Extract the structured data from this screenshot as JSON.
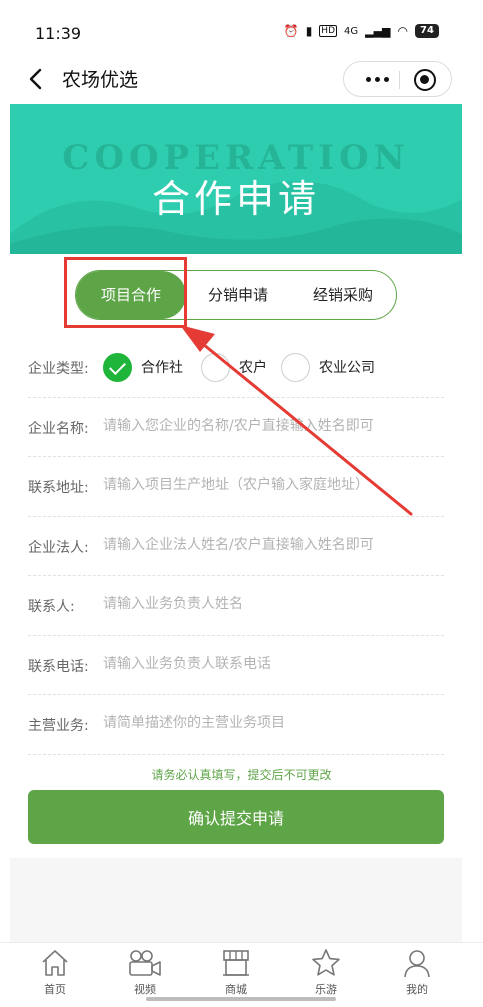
{
  "status_bar": {
    "time": "11:39",
    "network": "4G",
    "battery": "74"
  },
  "nav": {
    "title": "农场优选"
  },
  "banner": {
    "bg_text": "COOPERATION",
    "title": "合作申请"
  },
  "tabs": [
    {
      "label": "项目合作",
      "active": true
    },
    {
      "label": "分销申请",
      "active": false
    },
    {
      "label": "经销采购",
      "active": false
    }
  ],
  "form": {
    "type_label": "企业类型:",
    "type_options": [
      {
        "label": "合作社",
        "checked": true
      },
      {
        "label": "农户",
        "checked": false
      },
      {
        "label": "农业公司",
        "checked": false
      }
    ],
    "fields": [
      {
        "label": "企业名称:",
        "placeholder": "请输入您企业的名称/农户直接输入姓名即可"
      },
      {
        "label": "联系地址:",
        "placeholder": "请输入项目生产地址（农户输入家庭地址）"
      },
      {
        "label": "企业法人:",
        "placeholder": "请输入企业法人姓名/农户直接输入姓名即可"
      },
      {
        "label": "联系人:",
        "placeholder": "请输入业务负责人姓名"
      },
      {
        "label": "联系电话:",
        "placeholder": "请输入业务负责人联系电话"
      },
      {
        "label": "主营业务:",
        "placeholder": "请简单描述你的主营业务项目"
      }
    ]
  },
  "notice": "请务必认真填写，提交后不可更改",
  "submit_label": "确认提交申请",
  "tabbar": [
    {
      "label": "首页",
      "icon": "home-icon"
    },
    {
      "label": "视频",
      "icon": "video-camera-icon"
    },
    {
      "label": "商城",
      "icon": "store-icon"
    },
    {
      "label": "乐游",
      "icon": "star-icon"
    },
    {
      "label": "我的",
      "icon": "user-icon"
    }
  ],
  "colors": {
    "primary": "#5ea548",
    "banner": "#2fcdb0",
    "annotation": "#e53b35",
    "radio_checked": "#1eb53a"
  }
}
